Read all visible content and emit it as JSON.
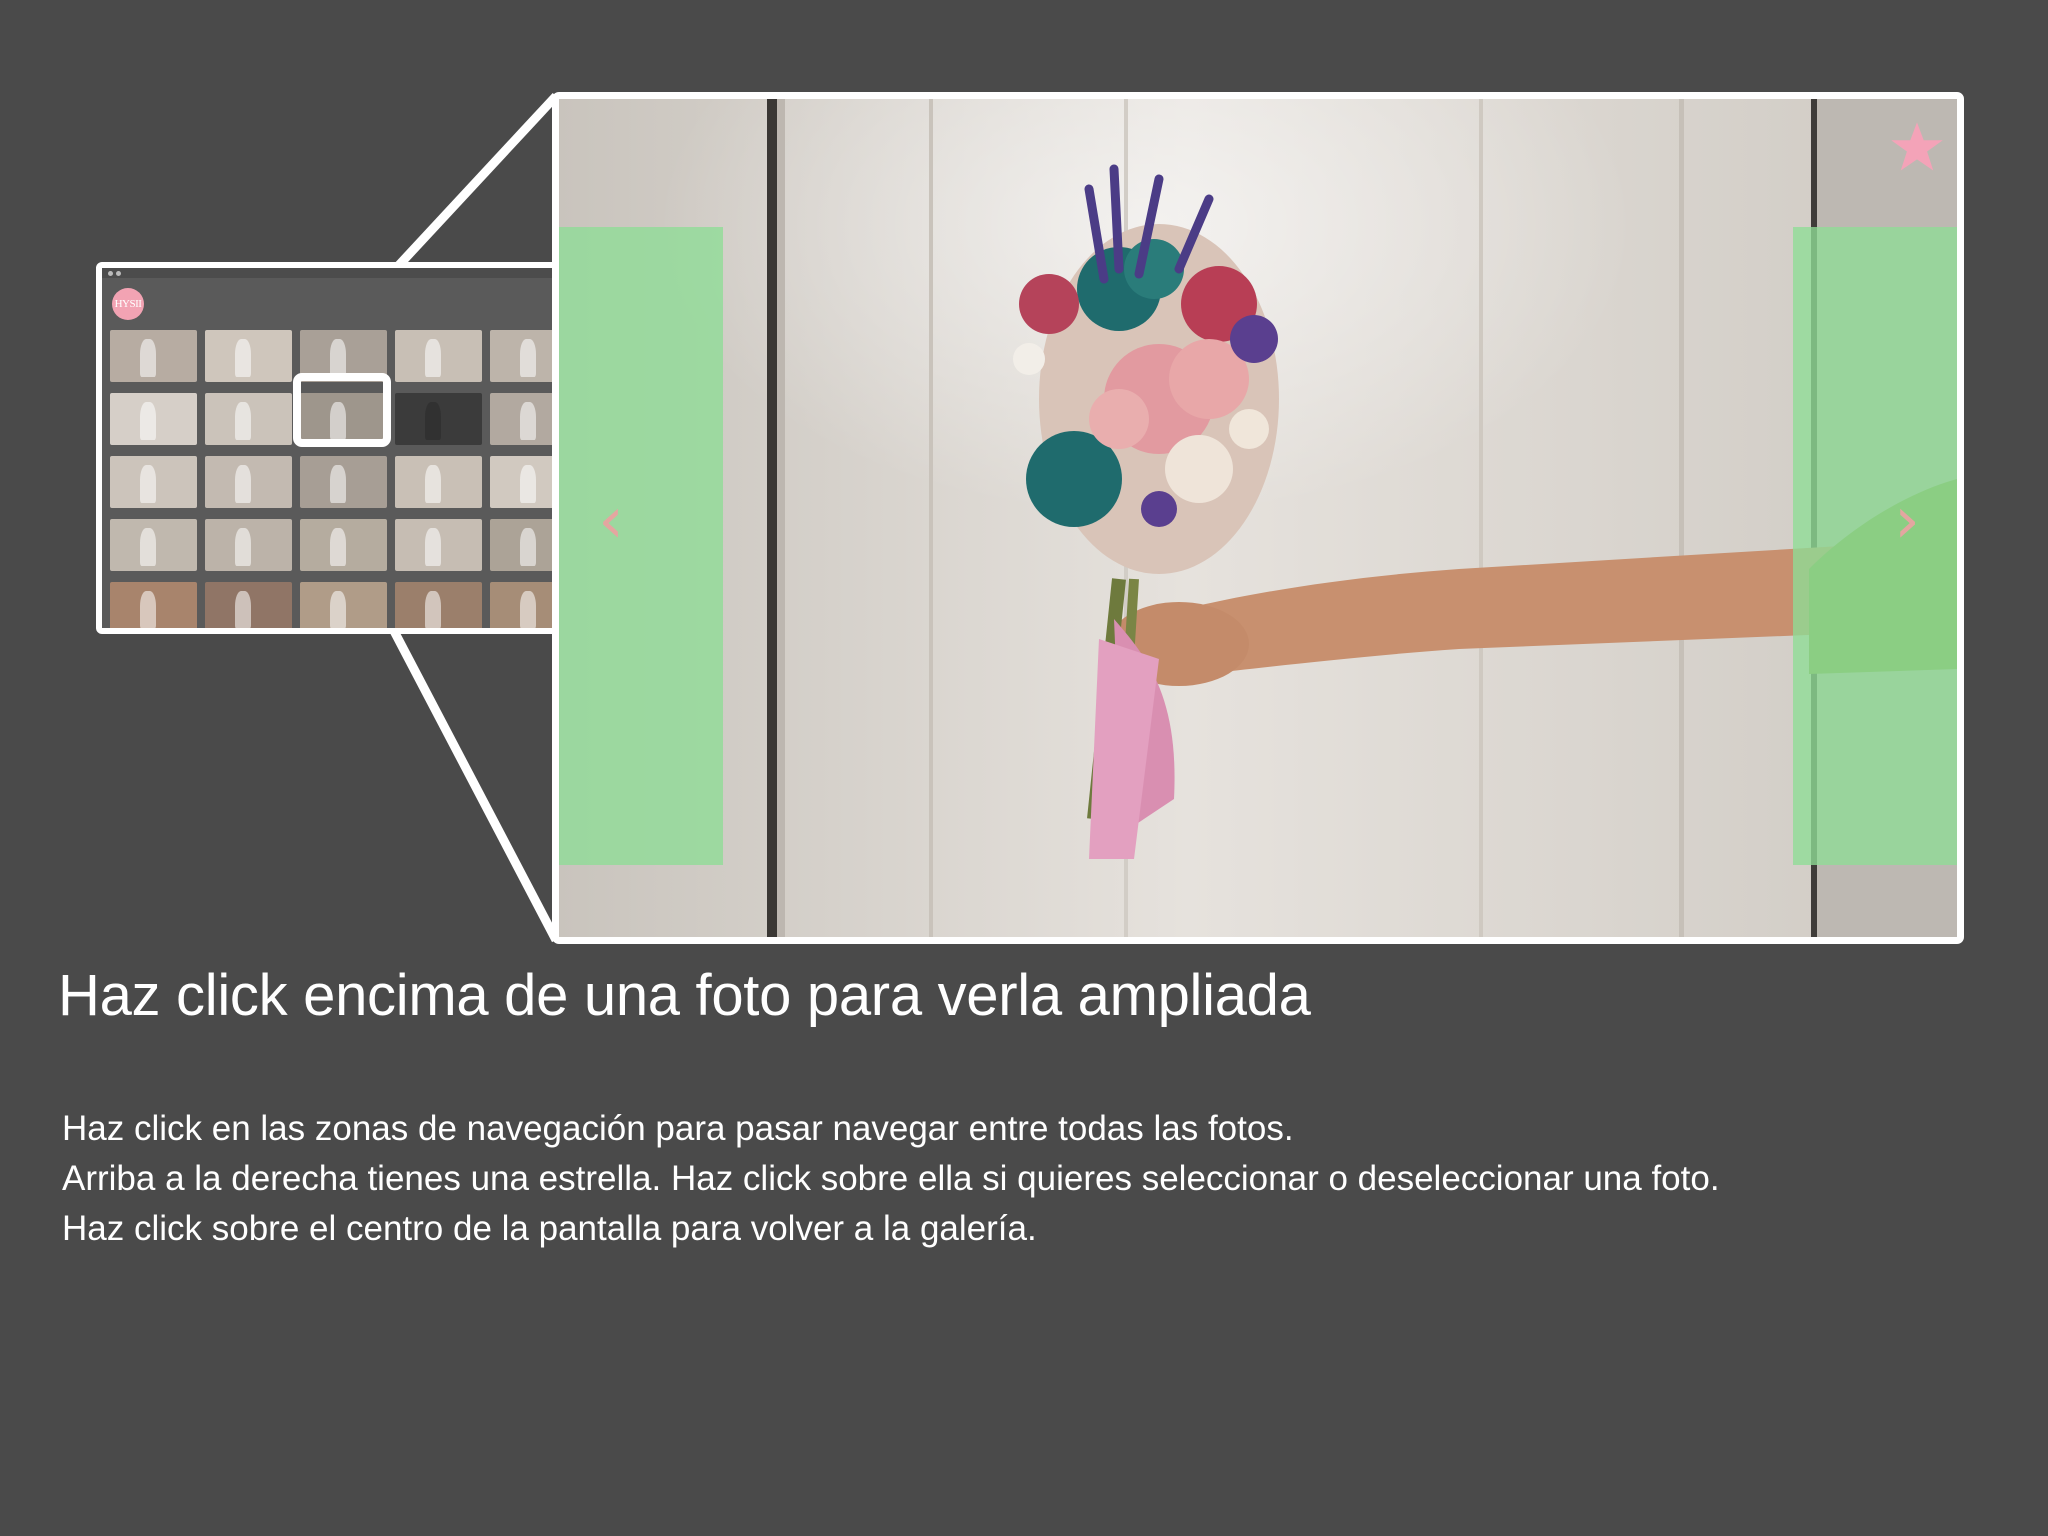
{
  "gallery": {
    "logo_text": "HYSII",
    "thumbnail_colors": [
      "#b7aca2",
      "#cfc6bc",
      "#a9a097",
      "#c8bfb5",
      "#bdb4aa",
      "#d6cfc8",
      "#cbc3ba",
      "#9e968c",
      "#3b3b3b",
      "#b2a9a0",
      "#ccc4bb",
      "#c3bab1",
      "#a79e95",
      "#c9c0b6",
      "#d1c9c0",
      "#c0b8ae",
      "#bcb3a9",
      "#b5ac9f",
      "#c6bdb3",
      "#aca397",
      "#a8846c",
      "#907566",
      "#b09c88",
      "#9b7f6b",
      "#a68d77"
    ]
  },
  "viewer": {
    "star_icon": "star-icon",
    "left_arrow": "‹",
    "right_arrow": "›",
    "colors": {
      "nav_zone": "#8edc96",
      "star": "#f4a3b8",
      "arrow": "#e4a6a0",
      "ribbon": "#d98fb1"
    }
  },
  "heading": "Haz click encima de una foto para verla ampliada",
  "instructions": [
    "Haz click en las zonas de navegación para pasar navegar entre todas las fotos.",
    "Arriba a la derecha tienes una estrella. Haz click sobre ella si quieres seleccionar o deseleccionar una foto.",
    "Haz click sobre el centro de la pantalla para volver a la galería."
  ]
}
